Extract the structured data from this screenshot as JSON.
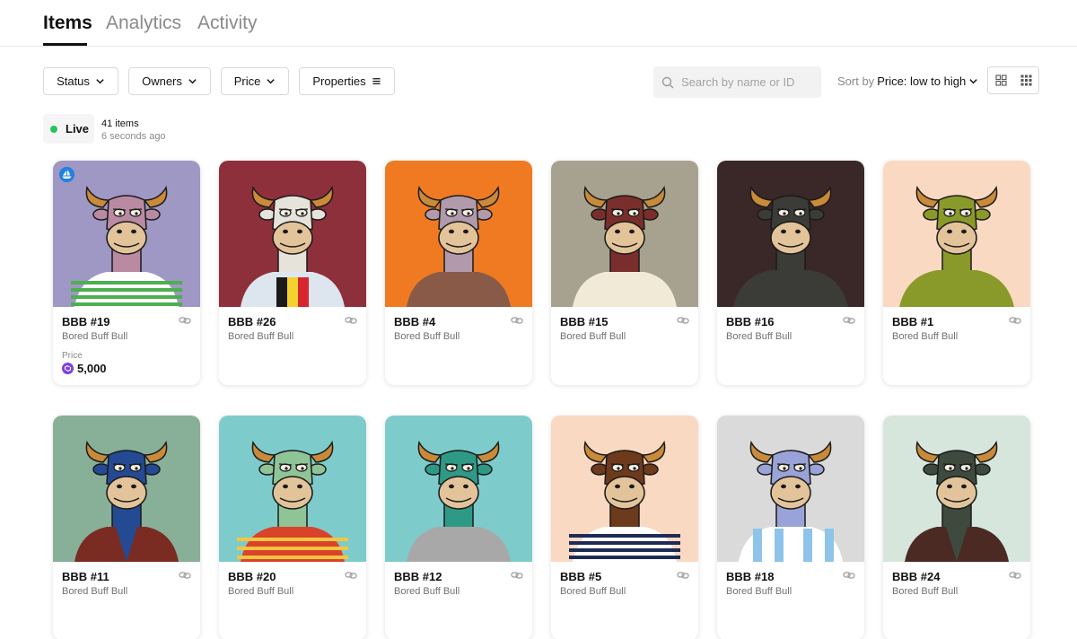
{
  "tabs": [
    {
      "label": "Items",
      "active": true
    },
    {
      "label": "Analytics",
      "active": false
    },
    {
      "label": "Activity",
      "active": false
    }
  ],
  "filters": {
    "status": "Status",
    "owners": "Owners",
    "price": "Price",
    "properties": "Properties"
  },
  "search": {
    "placeholder": "Search by name or ID"
  },
  "sort": {
    "label": "Sort by",
    "value": "Price: low to high"
  },
  "live": {
    "label": "Live",
    "count": "41 items",
    "updated": "6 seconds ago"
  },
  "price_label": "Price",
  "items": [
    {
      "name": "BBB #19",
      "collection": "Bored Buff Bull",
      "price": "5,000",
      "bg": "#9f97c4",
      "skin": "#b98aa2",
      "shirt": "stripe-green",
      "badge": true
    },
    {
      "name": "BBB #26",
      "collection": "Bored Buff Bull",
      "bg": "#8e2f3c",
      "skin": "#e6e3da",
      "shirt": "belgium"
    },
    {
      "name": "BBB #4",
      "collection": "Bored Buff Bull",
      "bg": "#f07a22",
      "skin": "#b19aab",
      "shirt": "brown"
    },
    {
      "name": "BBB #15",
      "collection": "Bored Buff Bull",
      "bg": "#a7a28f",
      "skin": "#7a2e2c",
      "shirt": "cream"
    },
    {
      "name": "BBB #16",
      "collection": "Bored Buff Bull",
      "bg": "#3a2828",
      "skin": "#3b3b37",
      "shirt": "dark"
    },
    {
      "name": "BBB #1",
      "collection": "Bored Buff Bull",
      "bg": "#f9d9c2",
      "skin": "#8a9a2a",
      "shirt": "olive"
    },
    {
      "name": "BBB #11",
      "collection": "Bored Buff Bull",
      "bg": "#88af98",
      "skin": "#244a93",
      "shirt": "vest"
    },
    {
      "name": "BBB #20",
      "collection": "Bored Buff Bull",
      "bg": "#7ecbcb",
      "skin": "#8fc497",
      "shirt": "stripe-red"
    },
    {
      "name": "BBB #12",
      "collection": "Bored Buff Bull",
      "bg": "#7ecbcb",
      "skin": "#2e9a86",
      "shirt": "grey"
    },
    {
      "name": "BBB #5",
      "collection": "Bored Buff Bull",
      "bg": "#f9d9c2",
      "skin": "#6e3a1c",
      "shirt": "stripe-navy"
    },
    {
      "name": "BBB #18",
      "collection": "Bored Buff Bull",
      "bg": "#dadada",
      "skin": "#9aa3d8",
      "shirt": "argentina"
    },
    {
      "name": "BBB #24",
      "collection": "Bored Buff Bull",
      "bg": "#d7e6dc",
      "skin": "#3e4a3e",
      "shirt": "vest-dark"
    }
  ]
}
